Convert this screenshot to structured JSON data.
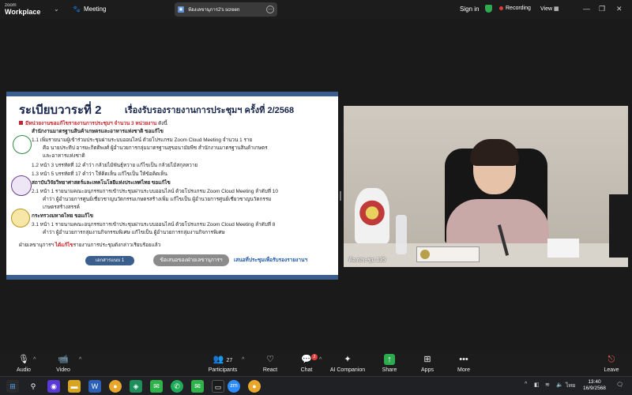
{
  "topbar": {
    "brand_small": "zoom",
    "brand_big": "Workplace",
    "meeting_label": "Meeting",
    "share_text": "ห้องเลขานุการ2's screen",
    "signin": "Sign in",
    "recording": "Recording",
    "view": "View"
  },
  "slide": {
    "title": "ระเบียบวาระที่ 2",
    "subtitle": "เรื่องรับรองรายงานการประชุมฯ ครั้งที่ 2/2568",
    "intro": "มีหน่วยงานขอแก้ไขรายงานการประชุมฯ จำนวน 3 หน่วยงาน",
    "intro_tail": "ดังนี้",
    "org1": "สำนักงานมาตรฐานสินค้าเกษตรและอาหารแห่งชาติ ขอแก้ไข",
    "org1_l1": "1.1  เพิ่มรายนามผู้เข้าร่วมประชุมผ่านระบบออนไลน์ ด้วยโปรแกรม Zoom Cloud Meeting จำนวน 1 ราย",
    "org1_l2": "คือ นายประทีป อารยะกิตติพงศ์ ผู้อำนวยการกลุ่มมาตรฐานสุขอนามัยพืช สำนักงานมาตรฐานสินค้าเกษตร",
    "org1_l3": "และอาหารแห่งชาติ",
    "org1_l4": "1.2  หน้า 3 บรรทัดที่ 12 คำว่า กล้วยไม้พันธุ์หวาย แก้ไขเป็น กล้วยไม้สกุลหวาย",
    "org1_l5": "1.3  หน้า 5 บรรทัดที่ 17 คำว่า ให้คิดเห็น แก้ไขเป็น ให้ข้อคิดเห็น",
    "org2": "สถาบันวิจัยวิทยาศาสตร์และเทคโนโลยีแห่งประเทศไทย ขอแก้ไข",
    "org2_l1": "2.1  หน้า 1 รายนามคณะอนุกรรมการเข้าประชุมผ่านระบบออนไลน์ ด้วยโปรแกรม Zoom Cloud Meeting ลำดับที่ 10",
    "org2_l2": "คำว่า ผู้อำนวยการศูนย์เชี่ยวชาญนวัตกรรมเกษตรสร้างเพิ่ม แก้ไขเป็น ผู้อำนวยการศูนย์เชี่ยวชาญนวัตกรรม",
    "org2_l3": "เกษตรสร้างสรรค์",
    "org3": "กระทรวงมหาดไทย ขอแก้ไข",
    "org3_l1": "3.1  หน้า 1 รายนามคณะอนุกรรมการเข้าประชุมผ่านระบบออนไลน์ ด้วยโปรแกรม Zoom Cloud Meeting ลำดับที่ 8",
    "org3_l2": "คำว่า ผู้อำนวยการกลุ่มงานกิจกรรมพิเศษ แก้ไขเป็น ผู้อำนวยการกลุ่มงานกิจการพิเศษ",
    "footer": "ฝ่ายเลขานุการฯ",
    "footer_red": "ได้แก้ไข",
    "footer_tail": "รายงานการประชุมดังกล่าวเรียบร้อยแล้ว",
    "doc_btn": "เอกสารแนบ 1",
    "sec_btn": "ข้อเสนอของฝ่ายเลขานุการฯ",
    "prop_text": "เสนอที่ประชุมเพื่อรับรองรายงานฯ"
  },
  "video": {
    "participant_label": "ห้องประชุม 135"
  },
  "toolbar": {
    "audio": "Audio",
    "video": "Video",
    "participants": "Participants",
    "participants_count": "27",
    "react": "React",
    "chat": "Chat",
    "chat_badge": "2",
    "ai": "AI Companion",
    "share": "Share",
    "apps": "Apps",
    "more": "More",
    "leave": "Leave"
  },
  "taskbar": {
    "lang": "ไทย",
    "time": "13:40",
    "date": "16/9/2568"
  },
  "colors": {
    "slide_navy": "#16244a",
    "slide_red": "#c3262c",
    "slide_bar": "#3b5f8c",
    "share_green": "#2eaa4f",
    "recording_red": "#e03c3c"
  }
}
